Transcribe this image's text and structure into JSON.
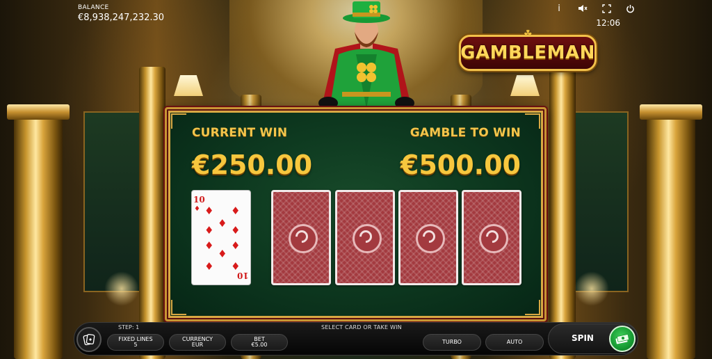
{
  "balance": {
    "label": "BALANCE",
    "value": "€8,938,247,232.30"
  },
  "top_icons": [
    {
      "name": "info-icon",
      "glyph": "i"
    },
    {
      "name": "sound-off-icon",
      "glyph": "🔇"
    },
    {
      "name": "fullscreen-icon",
      "glyph": "⤢"
    },
    {
      "name": "power-icon",
      "glyph": "⏻"
    }
  ],
  "clock": "12:06",
  "logo": {
    "text": "GAMBLEMAN"
  },
  "gamble": {
    "current_win_label": "CURRENT WIN",
    "current_win_value": "€250.00",
    "gamble_to_win_label": "GAMBLE TO WIN",
    "gamble_to_win_value": "€500.00",
    "dealer_card": {
      "rank": "10",
      "suit": "diamonds",
      "suit_glyph": "♦"
    },
    "face_down_cards": 4
  },
  "bottom_bar": {
    "step": "STEP: 1",
    "hint": "SELECT CARD OR TAKE WIN",
    "fixed_lines_label": "FIXED LINES",
    "fixed_lines_value": "5",
    "currency_label": "CURRENCY",
    "currency_value": "EUR",
    "bet_label": "BET",
    "bet_value": "€5.00",
    "turbo_label": "TURBO",
    "auto_label": "AUTO",
    "spin_label": "SPIN"
  },
  "colors": {
    "accent_gold": "#f7c73e",
    "table_green": "#0e3a20",
    "card_back_red": "#a33a3f",
    "spin_green": "#169a32"
  }
}
